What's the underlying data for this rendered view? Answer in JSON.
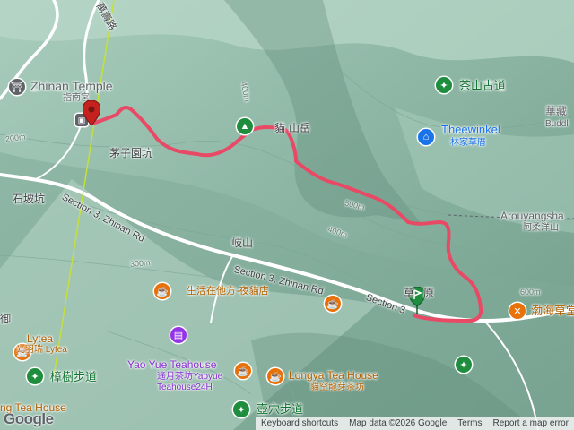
{
  "map": {
    "places": {
      "zhinan_temple_en": "Zhinan Temple",
      "zhinan_temple_zh": "指南宮",
      "chazishanyuan": "茅子園坑",
      "shipokeng": "石坡坑",
      "ershan_top": "山岳",
      "ershan_top_prefix": "貓",
      "tuoshan": "岐山",
      "tea_road_zh": "茶山古道",
      "theewinkel": "Theewinkel",
      "theewinkel_zh": "林家草厝",
      "arouyang": "Arouyangsha",
      "arouyang_zh": "阿柔洋山",
      "hua_zang": "華藏",
      "buddha": "Buddl",
      "cafe1": "生活在他方-夜貓店",
      "yao_yue_en": "Yao Yue Teahouse",
      "yao_yue_zh": "遙月茶坊Yaoyue",
      "yao_yue_24h": "Teahouse24H",
      "longya_en": "Longya Tea House",
      "longya_zh": "貓空龍芽茶坊",
      "zhangshu_trail": "樟樹步道",
      "hu_xue_trail": "壺穴步道",
      "lytea_en": "Lytea",
      "lytea_zh": "光羽瑞 Lytea",
      "lytea_prefix": "Lytea",
      "tea_house_left": "ng Tea House",
      "bohai": "渤海草堂",
      "cao": "草",
      "cao2": "原",
      "left_edge": "御",
      "road_vertical": "萬壽路"
    },
    "roads": {
      "section3_a": "Section 3, Zhinan Rd",
      "section3_b": "Section 3, Zhinan Rd",
      "section3_c": "Section 3"
    },
    "contours": {
      "c200": "200m",
      "c300": "300m",
      "c400a": "400m",
      "c400b": "400m",
      "c500": "500m",
      "c600": "600m"
    },
    "footer": {
      "shortcuts": "Keyboard shortcuts",
      "mapdata": "Map data ©2026 Google",
      "terms": "Terms",
      "report": "Report a map error"
    },
    "logo": "Google",
    "colors": {
      "track": "#e84a66",
      "start_marker": "#1e8e3e",
      "end_marker": "#c5221f",
      "terrain": "#8fb9a8"
    }
  }
}
